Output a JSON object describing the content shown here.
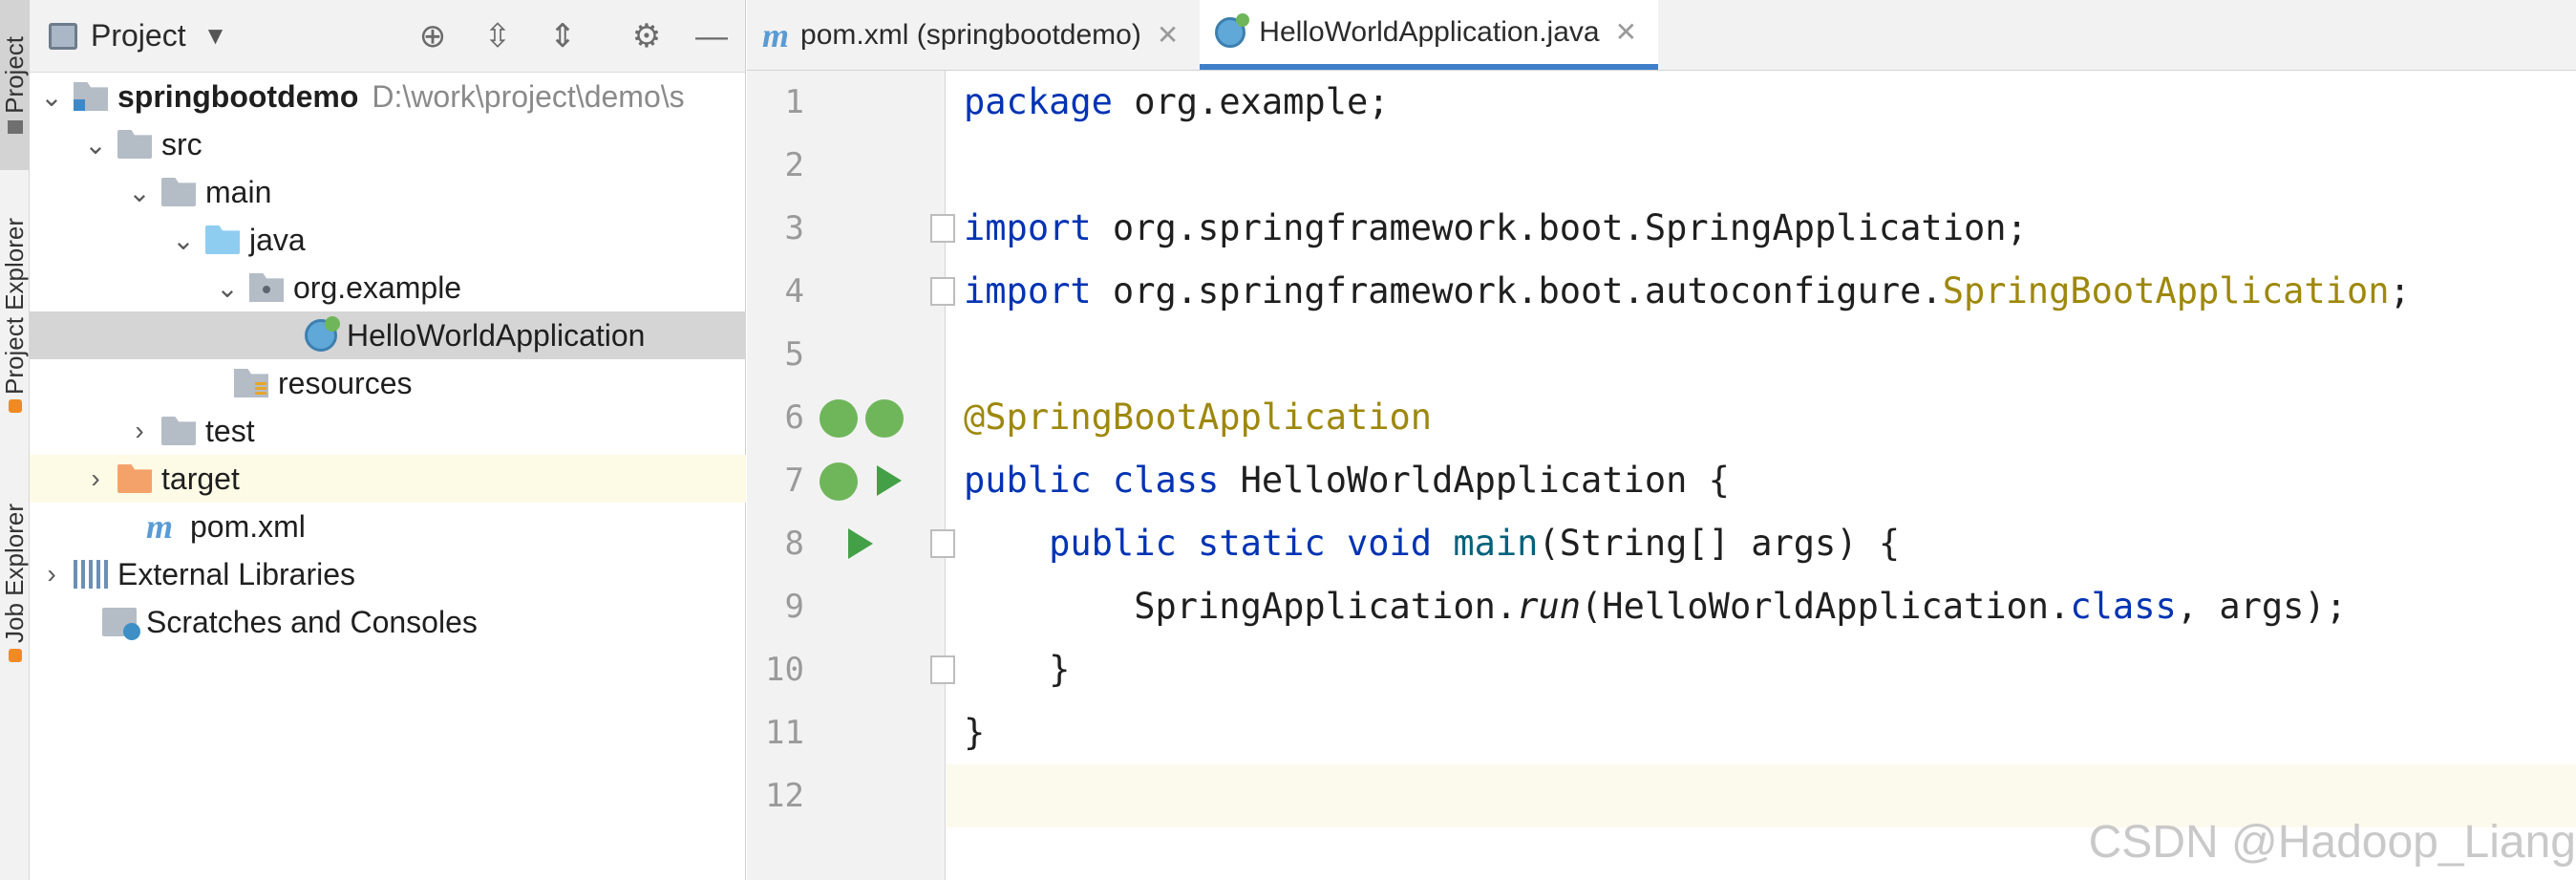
{
  "left_stripe": {
    "tabs": [
      {
        "label": "Project"
      },
      {
        "label": "Project Explorer"
      },
      {
        "label": "Job Explorer"
      }
    ]
  },
  "project_panel": {
    "title": "Project",
    "tree": [
      {
        "name": "springbootdemo",
        "path": "D:\\work\\project\\demo\\s"
      },
      {
        "name": "src"
      },
      {
        "name": "main"
      },
      {
        "name": "java"
      },
      {
        "name": "org.example"
      },
      {
        "name": "HelloWorldApplication"
      },
      {
        "name": "resources"
      },
      {
        "name": "test"
      },
      {
        "name": "target"
      },
      {
        "name": "pom.xml"
      },
      {
        "name": "External Libraries"
      },
      {
        "name": "Scratches and Consoles"
      }
    ]
  },
  "editor": {
    "tabs": [
      {
        "label": "pom.xml (springbootdemo)"
      },
      {
        "label": "HelloWorldApplication.java"
      }
    ],
    "line_numbers": [
      "1",
      "2",
      "3",
      "4",
      "5",
      "6",
      "7",
      "8",
      "9",
      "10",
      "11",
      "12"
    ],
    "code": {
      "l1_kw": "package",
      "l1_rest": " org.example;",
      "l3_kw": "import",
      "l3_rest": " org.springframework.boot.SpringApplication;",
      "l4_kw": "import",
      "l4_rest": " org.springframework.boot.autoconfigure.",
      "l4_ann": "SpringBootApplication",
      "l4_end": ";",
      "l6_ann": "@SpringBootApplication",
      "l7_kw": "public class",
      "l7_rest": " HelloWorldApplication {",
      "l8_indent": "    ",
      "l8_kw": "public static void",
      "l8_sp": " ",
      "l8_fn": "main",
      "l8_rest": "(String[] args) {",
      "l9_a": "        SpringApplication.",
      "l9_it": "run",
      "l9_b": "(HelloWorldApplication.",
      "l9_kw": "class",
      "l9_c": ", args);",
      "l10": "    }",
      "l11": "}"
    }
  },
  "watermark": "CSDN @Hadoop_Liang",
  "colors": {
    "keyword": "#0033b3",
    "annotation": "#9e880d",
    "method": "#00627a",
    "active_tab": "#3f7fc9",
    "run_icon": "#43a047"
  },
  "icons": [
    "locate-icon",
    "expand-all-icon",
    "collapse-all-icon",
    "gear-icon",
    "minimize-icon"
  ]
}
